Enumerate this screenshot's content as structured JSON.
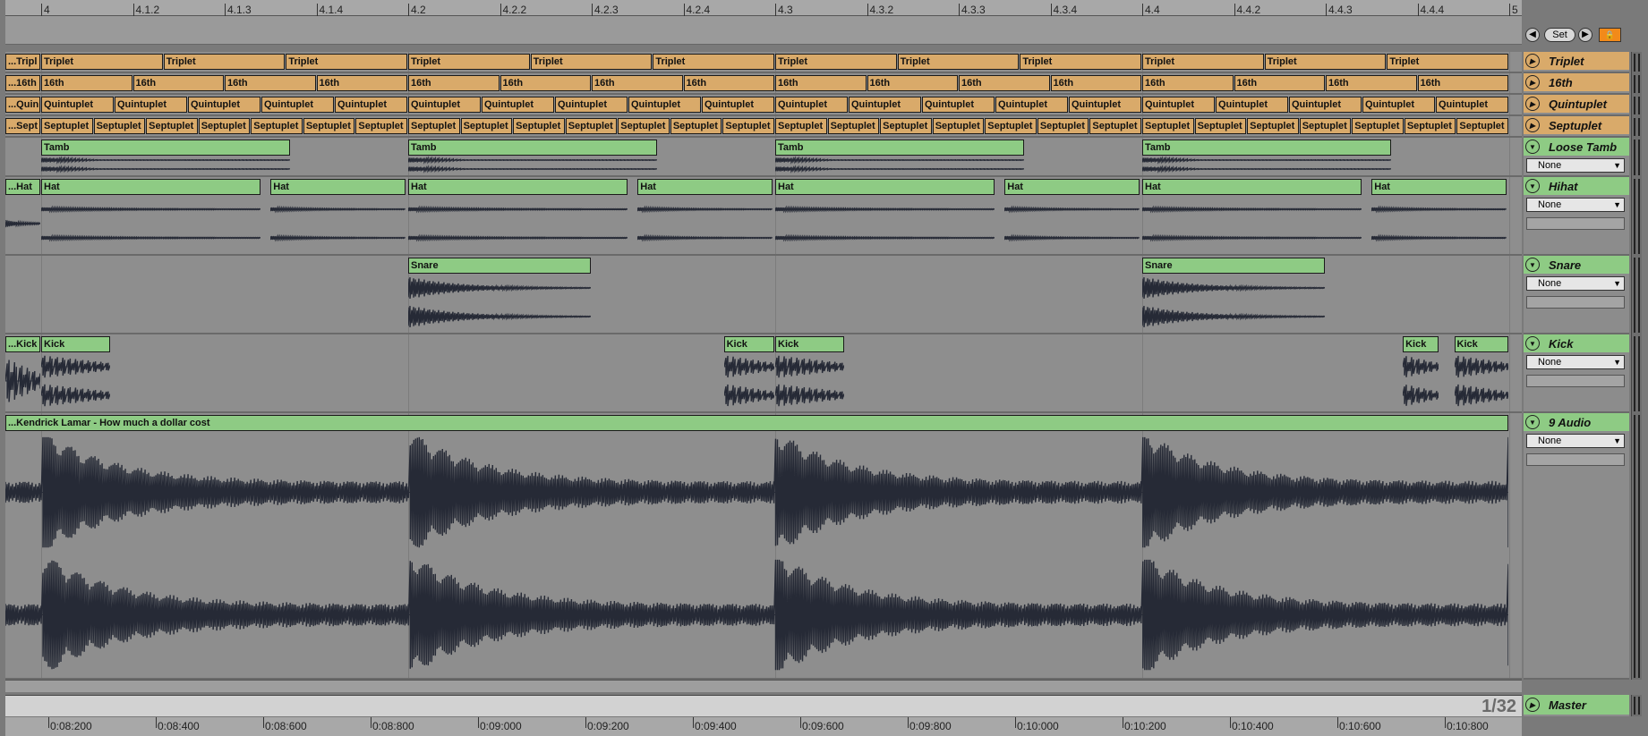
{
  "ruler_top": [
    "4",
    "4.1.2",
    "4.1.3",
    "4.1.4",
    "4.2",
    "4.2.2",
    "4.2.3",
    "4.2.4",
    "4.3",
    "4.3.2",
    "4.3.3",
    "4.3.4",
    "4.4",
    "4.4.2",
    "4.4.3",
    "4.4.4",
    "5"
  ],
  "ruler_bottom": [
    "0:08:200",
    "0:08:400",
    "0:08:600",
    "0:08:800",
    "0:09:000",
    "0:09:200",
    "0:09:400",
    "0:09:600",
    "0:09:800",
    "0:10:000",
    "0:10:200",
    "0:10:400",
    "0:10:600",
    "0:10:800"
  ],
  "transport": {
    "set_label": "Set",
    "prev_icon": "arrow-left-icon",
    "next_icon": "arrow-right-icon",
    "lock_icon": "lock-icon"
  },
  "zoom_label": "1/32",
  "colors": {
    "midi_clip": "#d9aa6a",
    "audio_clip": "#8ecb84",
    "lock": "#f28a1a",
    "waveform": "#262a36"
  },
  "tracks": [
    {
      "id": "triplet",
      "name": "Triplet",
      "color": "tan",
      "clip_label": "Triplet",
      "truncated_label": "...Tripl"
    },
    {
      "id": "16th",
      "name": "16th",
      "color": "tan",
      "clip_label": "16th",
      "truncated_label": "...16th"
    },
    {
      "id": "quintuplet",
      "name": "Quintuplet",
      "color": "tan",
      "clip_label": "Quintuplet",
      "truncated_label": "...Quin"
    },
    {
      "id": "septuplet",
      "name": "Septuplet",
      "color": "tan",
      "clip_label": "Septuplet",
      "truncated_label": "...Sept"
    },
    {
      "id": "loose-tamb",
      "name": "Loose Tamb",
      "color": "green",
      "clip_label": "Tamb",
      "input": "None"
    },
    {
      "id": "hihat",
      "name": "Hihat",
      "color": "green",
      "clip_label": "Hat",
      "truncated_label": "...Hat",
      "input": "None"
    },
    {
      "id": "snare",
      "name": "Snare",
      "color": "green",
      "clip_label": "Snare",
      "input": "None"
    },
    {
      "id": "kick",
      "name": "Kick",
      "color": "green",
      "clip_label": "Kick",
      "truncated_label": "...Kick",
      "input": "None"
    },
    {
      "id": "audio9",
      "name": "9 Audio",
      "color": "green",
      "clip_label": "...Kendrick Lamar - How much a dollar cost",
      "input": "None"
    }
  ],
  "master": {
    "name": "Master"
  },
  "input_options": [
    "None"
  ]
}
